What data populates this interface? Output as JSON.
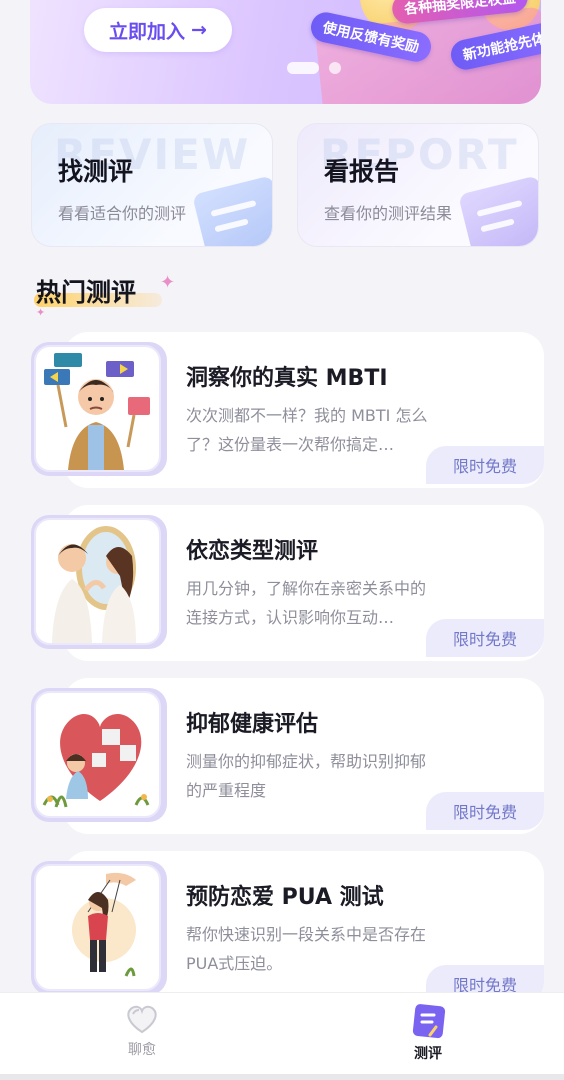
{
  "banner": {
    "join_label": "立即加入",
    "arrow": "→",
    "tags": [
      "各种抽奖限定权益",
      "使用反馈有奖励",
      "新功能抢先体验"
    ]
  },
  "quick_cards": [
    {
      "title": "找测评",
      "subtitle": "看看适合你的测评",
      "watermark": "REVIEW"
    },
    {
      "title": "看报告",
      "subtitle": "查看你的测评结果",
      "watermark": "REPORT"
    }
  ],
  "section": {
    "title": "热门测评"
  },
  "tests": [
    {
      "title": "洞察你的真实 MBTI",
      "desc": "次次测都不一样？我的 MBTI 怎么了？这份量表一次帮你搞定…",
      "badge": "限时免费"
    },
    {
      "title": "依恋类型测评",
      "desc": "用几分钟，了解你在亲密关系中的连接方式，认识影响你互动…",
      "badge": "限时免费"
    },
    {
      "title": "抑郁健康评估",
      "desc": "测量你的抑郁症状，帮助识别抑郁的严重程度",
      "badge": "限时免费"
    },
    {
      "title": "预防恋爱 PUA 测试",
      "desc": "帮你快速识别一段关系中是否存在PUA式压迫。",
      "badge": "限时免费"
    }
  ],
  "nav": {
    "items": [
      {
        "label": "聊愈",
        "icon": "heart-icon"
      },
      {
        "label": "测评",
        "icon": "notebook-icon"
      }
    ]
  },
  "colors": {
    "accent": "#6a4df0",
    "badge_bg": "#ecebfb",
    "badge_text": "#7278c9"
  }
}
